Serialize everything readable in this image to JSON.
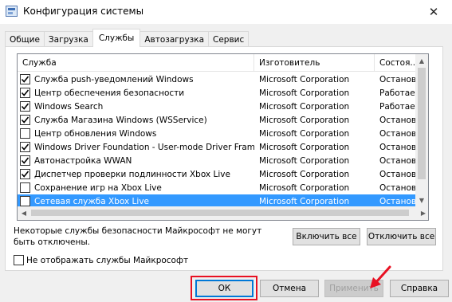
{
  "window": {
    "title": "Конфигурация системы",
    "close_glyph": "✕"
  },
  "tabs": [
    {
      "label": "Общие",
      "active": false
    },
    {
      "label": "Загрузка",
      "active": false
    },
    {
      "label": "Службы",
      "active": true
    },
    {
      "label": "Автозагрузка",
      "active": false
    },
    {
      "label": "Сервис",
      "active": false
    }
  ],
  "services": {
    "columns": {
      "name": "Служба",
      "maker": "Изготовитель",
      "status": "Состоя..."
    },
    "rows": [
      {
        "checked": true,
        "name": "Служба push-уведомлений Windows",
        "maker": "Microsoft Corporation",
        "status": "Останов",
        "selected": false
      },
      {
        "checked": true,
        "name": "Центр обеспечения безопасности",
        "maker": "Microsoft Corporation",
        "status": "Работает",
        "selected": false
      },
      {
        "checked": true,
        "name": "Windows Search",
        "maker": "Microsoft Corporation",
        "status": "Работает",
        "selected": false
      },
      {
        "checked": true,
        "name": "Служба Магазина Windows (WSService)",
        "maker": "Microsoft Corporation",
        "status": "Останов",
        "selected": false
      },
      {
        "checked": false,
        "name": "Центр обновления Windows",
        "maker": "Microsoft Corporation",
        "status": "Останов",
        "selected": false
      },
      {
        "checked": true,
        "name": "Windows Driver Foundation - User-mode Driver Frame...",
        "maker": "Microsoft Corporation",
        "status": "Останов",
        "selected": false
      },
      {
        "checked": true,
        "name": "Автонастройка WWAN",
        "maker": "Microsoft Corporation",
        "status": "Останов",
        "selected": false
      },
      {
        "checked": true,
        "name": "Диспетчер проверки подлинности Xbox Live",
        "maker": "Microsoft Corporation",
        "status": "Останов",
        "selected": false
      },
      {
        "checked": false,
        "name": "Сохранение игр на Xbox Live",
        "maker": "Microsoft Corporation",
        "status": "Останов",
        "selected": false
      },
      {
        "checked": false,
        "name": "Сетевая служба Xbox Live",
        "maker": "Microsoft Corporation",
        "status": "Останов",
        "selected": true
      }
    ]
  },
  "note": "Некоторые службы безопасности Майкрософт не могут быть отключены.",
  "buttons": {
    "enable_all": "Включить все",
    "disable_all": "Отключить все",
    "ok": "ОК",
    "cancel": "Отмена",
    "apply": "Применить",
    "help": "Справка"
  },
  "hide_ms": {
    "label": "Не отображать службы Майкрософт",
    "checked": false
  },
  "colors": {
    "selection": "#3399ff",
    "highlight_box": "#e81123",
    "arrow": "#e81123"
  }
}
